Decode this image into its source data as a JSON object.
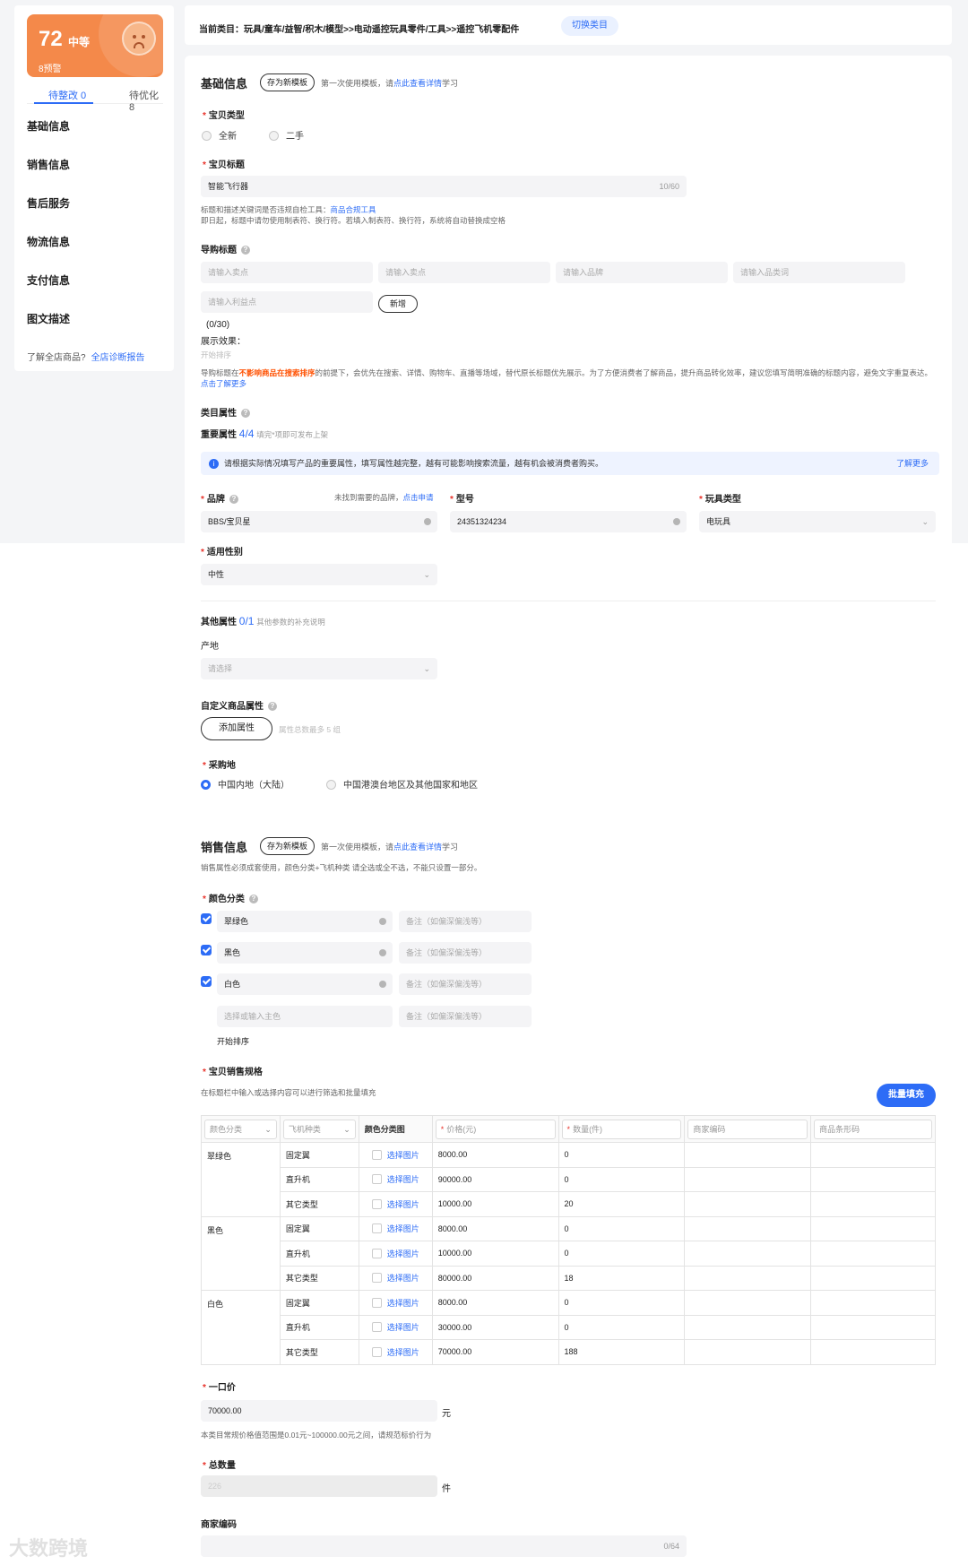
{
  "sidebar": {
    "score": "72",
    "level": "中等",
    "warn": "8预警",
    "tab_fix": "待整改 0",
    "tab_opt": "待优化 8",
    "nav": [
      "基础信息",
      "销售信息",
      "售后服务",
      "物流信息",
      "支付信息",
      "图文描述"
    ],
    "foot_text": "了解全店商品?",
    "foot_link": "全店诊断报告"
  },
  "top": {
    "category": "当前类目：玩具/童车/益智/积木/模型>>电动遥控玩具零件/工具>>遥控飞机零配件",
    "switch": "切换类目"
  },
  "basic": {
    "title": "基础信息",
    "save_tpl": "存为新模板",
    "tpl_hint": "第一次使用模板，请",
    "tpl_link": "点此查看详情",
    "tpl_hint2": "学习",
    "type_label": "宝贝类型",
    "type_new": "全新",
    "type_used": "二手",
    "title_label": "宝贝标题",
    "title_value": "智能飞行器",
    "title_count": "10/60",
    "title_hint1": "标题和描述关键词是否违规自检工具：",
    "title_hint1_link": "商品合规工具",
    "title_hint2": "即日起，标题中请勿使用制表符、换行符。若填入制表符、换行符，系统将自动替换成空格",
    "guide_label": "导购标题",
    "guide_ph": [
      "请输入卖点",
      "请输入卖点",
      "请输入品牌",
      "请输入品类词",
      "请输入利益点"
    ],
    "add": "新增",
    "guide_count": "(0/30)",
    "display_label": "展示效果：",
    "sort_hint": "开始排序",
    "guide_hint_pre": "导购标题在",
    "guide_hint_em": "不影响商品在搜索排序",
    "guide_hint_mid": "的前提下，会优先在搜索、详情、购物车、直播等场域，替代原长标题优先展示。为了方便消费者了解商品，提升商品转化效率，建议您填写简明准确的标题内容，避免文字重复",
    "guide_hint_end": "表达。",
    "guide_hint_link": "点击了解更多",
    "cat_attr": "类目属性",
    "important": "重要属性",
    "imp_count": "4/4",
    "imp_hint": "填完*项即可发布上架",
    "info": "请根据实际情况填写产品的重要属性，填写属性越完整，越有可能影响搜索流量，越有机会被消费者购买。",
    "info_link": "了解更多",
    "brand_label": "品牌",
    "brand_hint": "未找到需要的品牌，",
    "brand_link": "点击申请",
    "brand_value": "BBS/宝贝星",
    "model_label": "型号",
    "model_value": "24351324234",
    "toy_label": "玩具类型",
    "toy_value": "电玩具",
    "gender_label": "适用性别",
    "gender_value": "中性",
    "other_attr": "其他属性",
    "other_count": "0/1",
    "other_hint": "其他参数的补充说明",
    "origin_label": "产地",
    "origin_ph": "请选择",
    "custom_label": "自定义商品属性",
    "add_attr": "添加属性",
    "add_attr_hint": "属性总数最多 5 组",
    "purchase_label": "采购地",
    "purchase_opt1": "中国内地（大陆）",
    "purchase_opt2": "中国港澳台地区及其他国家和地区"
  },
  "sales": {
    "title": "销售信息",
    "save_tpl": "存为新模板",
    "tpl_hint": "第一次使用模板，请",
    "tpl_link": "点此查看详情",
    "tpl_hint2": "学习",
    "hint": "销售属性必须成套使用，颜色分类+飞机种类 请全选或全不选，不能只设置一部分。",
    "color_label": "颜色分类",
    "colors": [
      "翠绿色",
      "黑色",
      "白色"
    ],
    "color_ph": "选择或输入主色",
    "remark_ph": "备注（如偏深偏浅等）",
    "sort_hint": "开始排序",
    "spec_label": "宝贝销售规格",
    "spec_hint": "在标题栏中输入或选择内容可以进行筛选和批量填充",
    "batch": "批量填充",
    "headers": [
      "颜色分类",
      "飞机种类",
      "颜色分类图",
      "价格(元)",
      "数量(件)",
      "商家编码",
      "商品条形码"
    ],
    "pick_img": "选择图片",
    "rows": [
      {
        "color": "翠绿色",
        "type": "固定翼",
        "price": "8000.00",
        "qty": "0"
      },
      {
        "color": "",
        "type": "直升机",
        "price": "90000.00",
        "qty": "0"
      },
      {
        "color": "",
        "type": "其它类型",
        "price": "10000.00",
        "qty": "20"
      },
      {
        "color": "黑色",
        "type": "固定翼",
        "price": "8000.00",
        "qty": "0"
      },
      {
        "color": "",
        "type": "直升机",
        "price": "10000.00",
        "qty": "0"
      },
      {
        "color": "",
        "type": "其它类型",
        "price": "80000.00",
        "qty": "18"
      },
      {
        "color": "白色",
        "type": "固定翼",
        "price": "8000.00",
        "qty": "0"
      },
      {
        "color": "",
        "type": "直升机",
        "price": "30000.00",
        "qty": "0"
      },
      {
        "color": "",
        "type": "其它类型",
        "price": "70000.00",
        "qty": "188"
      }
    ],
    "price_label": "一口价",
    "price_value": "70000.00",
    "price_unit": "元",
    "price_hint": "本类目常规价格值范围是0.01元~100000.00元之间，请规范标价行为",
    "total_label": "总数量",
    "total_value": "226",
    "total_unit": "件",
    "code_label": "商家编码",
    "code_count": "0/64"
  },
  "watermark": "大数跨境"
}
